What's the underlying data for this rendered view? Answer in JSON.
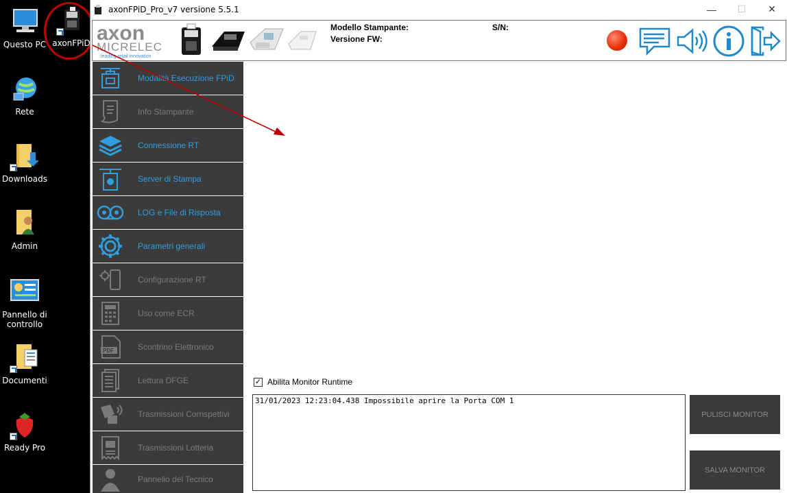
{
  "desktop": {
    "icons": [
      {
        "label": "Questo PC"
      },
      {
        "label": "axonFPiD"
      },
      {
        "label": "Rete"
      },
      {
        "label": "Downloads"
      },
      {
        "label": "Admin"
      },
      {
        "label": "Pannello di controllo"
      },
      {
        "label": "Documenti"
      },
      {
        "label": "Ready Pro"
      }
    ],
    "highlight_color": "#c00000"
  },
  "window": {
    "title": "axonFPiD_Pro_v7 versione 5.5.1",
    "controls": {
      "minimize": "—",
      "maximize": "☐",
      "close": "✕"
    }
  },
  "header": {
    "logo_top": "axon",
    "logo_bottom": "MICRELEC",
    "logo_tagline": "leading retail innovation",
    "model_label": "Modello Stampante:",
    "fw_label": "Versione FW:",
    "sn_label": "S/N:",
    "status_color": "#e8310d",
    "icons": [
      "messages-icon",
      "speaker-icon",
      "info-icon",
      "exit-icon"
    ],
    "accent": "#1e88c8"
  },
  "sidebar": {
    "items": [
      {
        "label": "Modalità Esecuzione FPiD",
        "active": true,
        "icon": "printer-server-icon"
      },
      {
        "label": "Info Stampante",
        "active": false,
        "icon": "receipt-icon"
      },
      {
        "label": "Connessione RT",
        "active": true,
        "icon": "layers-icon"
      },
      {
        "label": "Server di Stampa",
        "active": true,
        "icon": "print-server-icon"
      },
      {
        "label": "LOG e File di Risposta",
        "active": true,
        "icon": "tape-icon"
      },
      {
        "label": "Parametri generali",
        "active": true,
        "icon": "gear-icon"
      },
      {
        "label": "Configurazione RT",
        "active": false,
        "icon": "settings-device-icon"
      },
      {
        "label": "Uso come ECR",
        "active": false,
        "icon": "calculator-icon"
      },
      {
        "label": "Scontrino Elettronico",
        "active": false,
        "icon": "pdf-icon"
      },
      {
        "label": "Lettura DFGE",
        "active": false,
        "icon": "documents-icon"
      },
      {
        "label": "Trasmissioni Corrispettivi",
        "active": false,
        "icon": "transmit-icon"
      },
      {
        "label": "Trasmissioni Lotteria",
        "active": false,
        "icon": "lottery-receipt-icon"
      },
      {
        "label": "Pannello del Tecnico",
        "active": false,
        "icon": "technician-icon"
      }
    ],
    "active_color": "#2f9ee0",
    "inactive_color": "#7a7a7a"
  },
  "monitor": {
    "checkbox_label": "Abilita Monitor Runtime",
    "checked": true,
    "log_text": "31/01/2023 12:23:04.438  Impossibile aprire la Porta COM 1",
    "clear_button": "PULISCI MONITOR",
    "save_button": "SALVA MONITOR"
  }
}
